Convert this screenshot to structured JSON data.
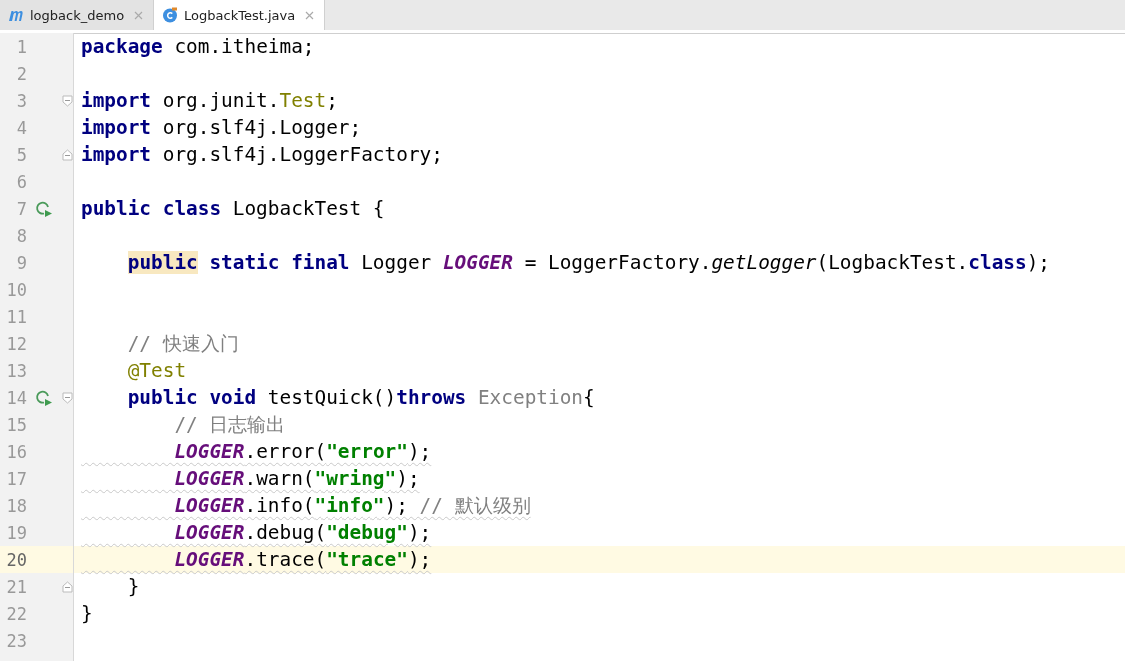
{
  "tabs": [
    {
      "label": "logback_demo",
      "kind": "module",
      "selected": false
    },
    {
      "label": "LogbackTest.java",
      "kind": "class",
      "selected": true
    }
  ],
  "editor": {
    "lines": [
      {
        "number": "1",
        "tokens": [
          {
            "kind": "kw",
            "t": "package"
          },
          {
            "kind": "plain",
            "t": " com.itheima;"
          }
        ]
      },
      {
        "number": "2"
      },
      {
        "number": "3",
        "fold_start": true,
        "tokens": [
          {
            "kind": "kw",
            "t": "import"
          },
          {
            "kind": "plain",
            "t": " org.junit."
          },
          {
            "kind": "type",
            "t": "Test"
          },
          {
            "kind": "plain",
            "t": ";"
          }
        ]
      },
      {
        "number": "4",
        "tokens": [
          {
            "kind": "kw",
            "t": "import"
          },
          {
            "kind": "plain",
            "t": " org.slf4j.Logger;"
          }
        ]
      },
      {
        "number": "5",
        "fold_end": true,
        "tokens": [
          {
            "kind": "kw",
            "t": "import"
          },
          {
            "kind": "plain",
            "t": " org.slf4j.LoggerFactory;"
          }
        ]
      },
      {
        "number": "6"
      },
      {
        "number": "7",
        "run_marker": true,
        "tokens": [
          {
            "kind": "kw",
            "t": "public class"
          },
          {
            "kind": "plain",
            "t": " LogbackTest {"
          }
        ]
      },
      {
        "number": "8"
      },
      {
        "number": "9",
        "tokens": [
          {
            "kind": "kw",
            "t": "    public",
            "highlighted": true
          },
          {
            "kind": "kw",
            "t": " static final"
          },
          {
            "kind": "plain",
            "t": " Logger "
          },
          {
            "kind": "field",
            "t": "LOGGER"
          },
          {
            "kind": "plain",
            "t": " = LoggerFactory."
          },
          {
            "kind": "method",
            "t": "getLogger"
          },
          {
            "kind": "plain",
            "t": "(LogbackTest."
          },
          {
            "kind": "kw",
            "t": "class"
          },
          {
            "kind": "plain",
            "t": ");"
          }
        ]
      },
      {
        "number": "10"
      },
      {
        "number": "11"
      },
      {
        "number": "12",
        "tokens": [
          {
            "kind": "comment",
            "t": "    // 快速入门"
          }
        ]
      },
      {
        "number": "13",
        "tokens": [
          {
            "kind": "annotation",
            "t": "    @Test"
          }
        ]
      },
      {
        "number": "14",
        "run_marker": true,
        "fold_start": true,
        "tokens": [
          {
            "kind": "kw",
            "t": "    public void"
          },
          {
            "kind": "plain",
            "t": " testQuick()"
          },
          {
            "kind": "kw",
            "t": "throws"
          },
          {
            "kind": "muted",
            "t": " Exception"
          },
          {
            "kind": "plain",
            "t": "{"
          }
        ]
      },
      {
        "number": "15",
        "tokens": [
          {
            "kind": "comment",
            "t": "        // 日志输出"
          }
        ]
      },
      {
        "number": "16",
        "warning": true,
        "tokens": [
          {
            "kind": "field",
            "t": "        LOGGER"
          },
          {
            "kind": "plain",
            "t": ".error("
          },
          {
            "kind": "string",
            "t": "\"error\""
          },
          {
            "kind": "plain",
            "t": ");"
          }
        ]
      },
      {
        "number": "17",
        "warning": true,
        "tokens": [
          {
            "kind": "field",
            "t": "        LOGGER"
          },
          {
            "kind": "plain",
            "t": ".warn("
          },
          {
            "kind": "string",
            "t": "\"wring\""
          },
          {
            "kind": "plain",
            "t": ");"
          }
        ]
      },
      {
        "number": "18",
        "warning": true,
        "tokens": [
          {
            "kind": "field",
            "t": "        LOGGER"
          },
          {
            "kind": "plain",
            "t": ".info("
          },
          {
            "kind": "string",
            "t": "\"info\""
          },
          {
            "kind": "plain",
            "t": "); "
          },
          {
            "kind": "comment",
            "t": "// 默认级别"
          }
        ]
      },
      {
        "number": "19",
        "warning": true,
        "tokens": [
          {
            "kind": "field",
            "t": "        LOGGER"
          },
          {
            "kind": "plain",
            "t": ".debug("
          },
          {
            "kind": "string",
            "t": "\"debug\""
          },
          {
            "kind": "plain",
            "t": ");"
          }
        ]
      },
      {
        "number": "20",
        "warning": true,
        "current": true,
        "tokens": [
          {
            "kind": "field",
            "t": "        LOGGER"
          },
          {
            "kind": "plain",
            "t": ".trace("
          },
          {
            "kind": "string",
            "t": "\"trace\""
          },
          {
            "kind": "plain",
            "t": ");"
          }
        ]
      },
      {
        "number": "21",
        "fold_end": true,
        "tokens": [
          {
            "kind": "plain",
            "t": "    }"
          }
        ]
      },
      {
        "number": "22",
        "tokens": [
          {
            "kind": "plain",
            "t": "}"
          }
        ]
      },
      {
        "number": "23"
      }
    ]
  }
}
